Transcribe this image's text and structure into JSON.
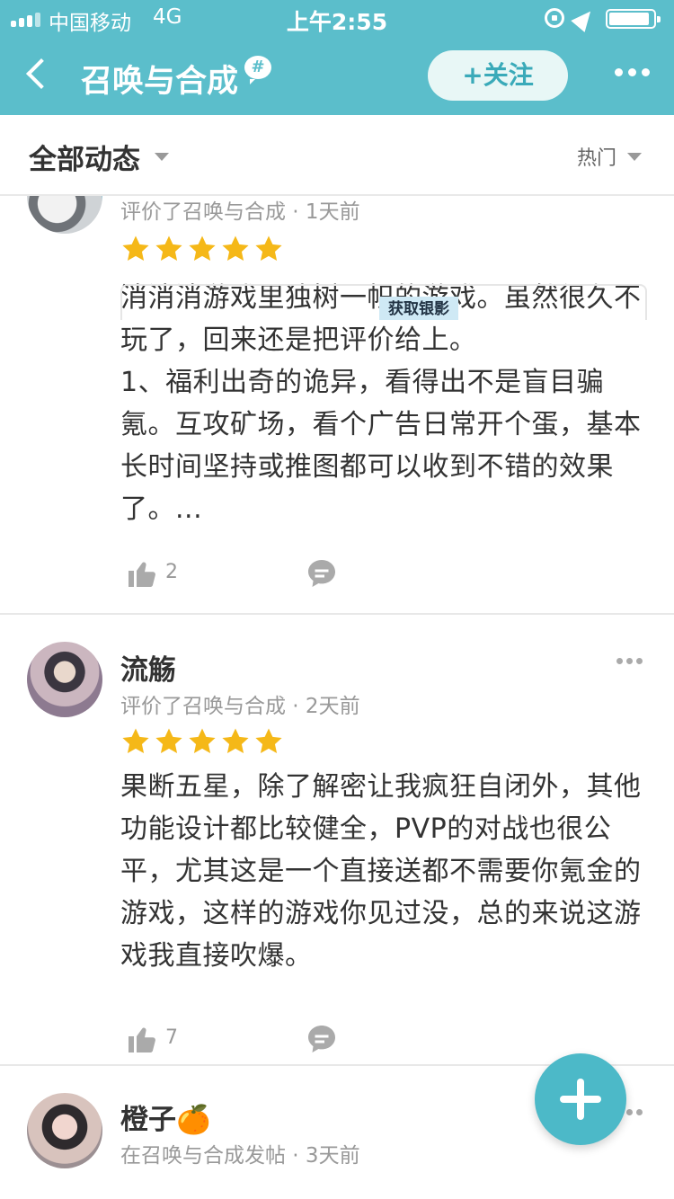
{
  "status_bar": {
    "carrier": "中国移动",
    "network": "4G",
    "time": "上午2:55"
  },
  "header": {
    "title": "召唤与合成",
    "hash_badge": "#",
    "follow_label": "+关注"
  },
  "filter": {
    "left_label": "全部动态",
    "right_label": "热门"
  },
  "posts": [
    {
      "name": "",
      "meta": "评价了召唤与合成 · 1天前",
      "rating": 5,
      "text": "消消消游戏里独树一帜的游戏。虽然很久不玩了，回来还是把评价给上。\n1、福利出奇的诡异，看得出不是盲目骗氪。互攻矿场，看个广告日常开个蛋，基本长时间坚持或推图都可以收到不错的效果了。...",
      "likes": "2"
    },
    {
      "name": "流觞",
      "meta": "评价了召唤与合成 · 2天前",
      "rating": 5,
      "text": "果断五星，除了解密让我疯狂自闭外，其他功能设计都比较健全，PVP的对战也很公平，尤其这是一个直接送都不需要你氪金的游戏，这样的游戏你见过没，总的来说这游戏我直接吹爆。",
      "likes": "7"
    },
    {
      "name": "橙子🍊",
      "meta": "在召唤与合成发帖 · 3天前",
      "attachment_tag": "获取银影"
    }
  ],
  "colors": {
    "header_bg": "#5bbecb",
    "star": "#f5b818",
    "fab": "#4cb9c8"
  }
}
